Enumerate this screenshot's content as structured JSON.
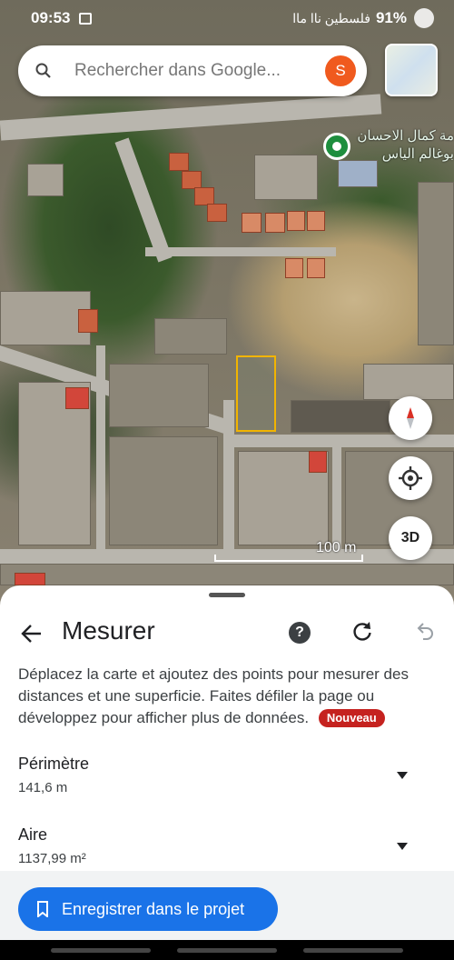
{
  "status_bar": {
    "time": "09:53",
    "network": "فلسطين  ناا ماا",
    "battery": "91%"
  },
  "search": {
    "placeholder": "Rechercher dans Google...",
    "avatar_letter": "S"
  },
  "map": {
    "place_label_line1": "مة كمال الاحسان",
    "place_label_line2": "بوغالم الياس",
    "scale_label": "100 m",
    "button_3d": "3D"
  },
  "sheet": {
    "title": "Mesurer",
    "help_label": "?",
    "description": "Déplacez la carte et ajoutez des points pour mesurer des distances et une superficie. Faites défiler la page ou développez pour afficher plus de données.",
    "new_badge": "Nouveau",
    "perimeter_label": "Périmètre",
    "perimeter_value": "141,6 m",
    "area_label": "Aire",
    "area_value": "1137,99 m²",
    "save_button": "Enregistrer dans le projet"
  },
  "colors": {
    "accent_blue": "#1a73e8",
    "badge_red": "#c5221f",
    "plot_outline": "#f2b400",
    "avatar_orange": "#f05a1e",
    "pin_green": "#1e8e3e"
  }
}
